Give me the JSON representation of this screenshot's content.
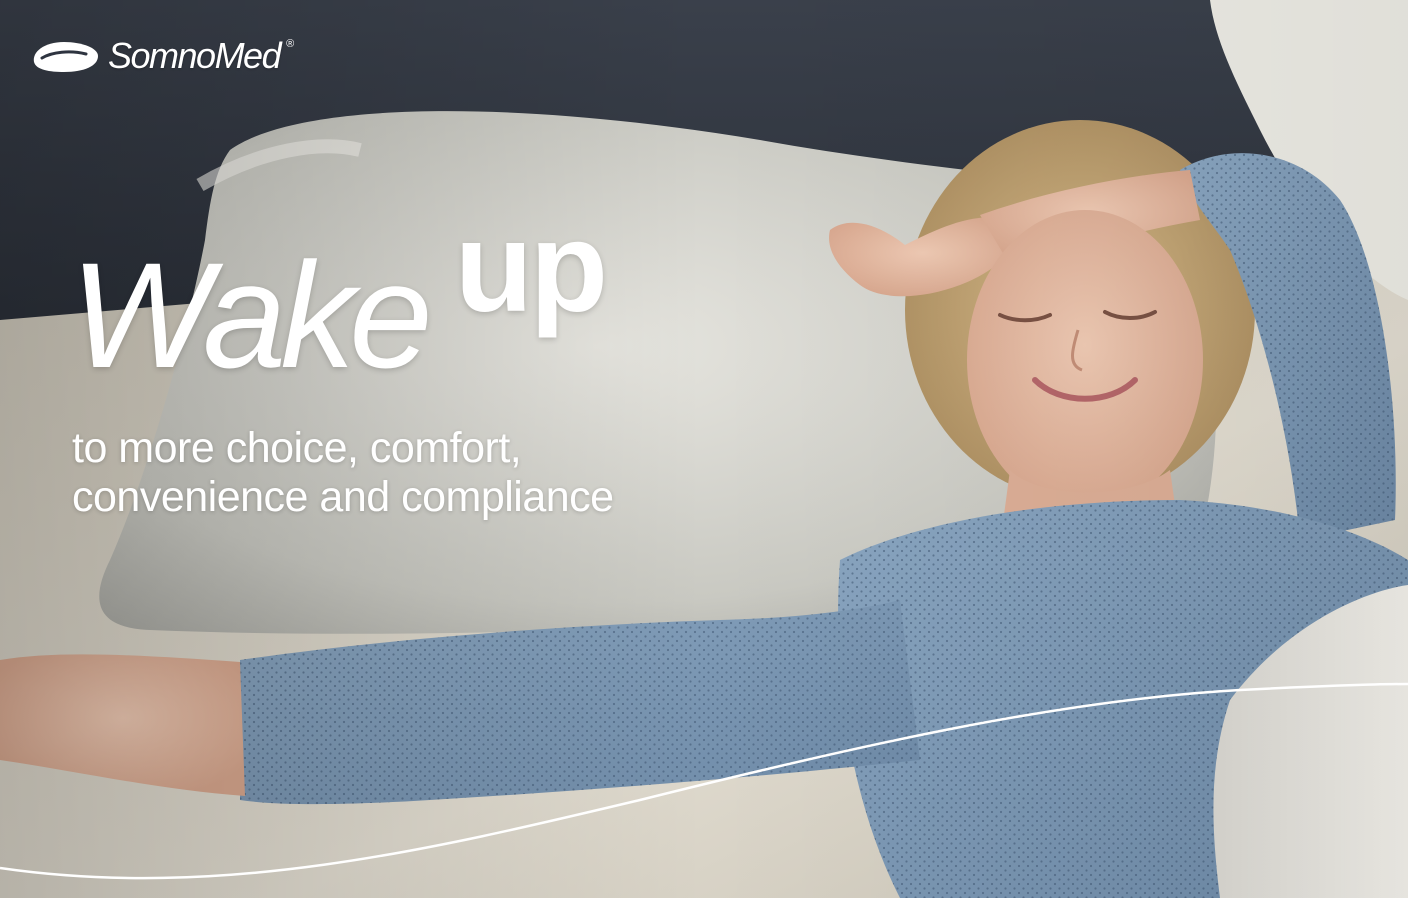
{
  "brand": {
    "name": "SomnoMed",
    "registered_mark": "®",
    "logo_icon": "pillow-logo-icon"
  },
  "headline": {
    "word_1": "Wake",
    "word_2": "up"
  },
  "tagline": {
    "line_1": "to more choice, comfort,",
    "line_2": "convenience and compliance"
  },
  "colors": {
    "text": "#ffffff",
    "headboard": "#2e3440",
    "pillow": "#d9d9d2",
    "sheet": "#d6d1c6",
    "pajama": "#7f9cb8",
    "skin": "#e3b9a1",
    "hair": "#c8a874"
  }
}
